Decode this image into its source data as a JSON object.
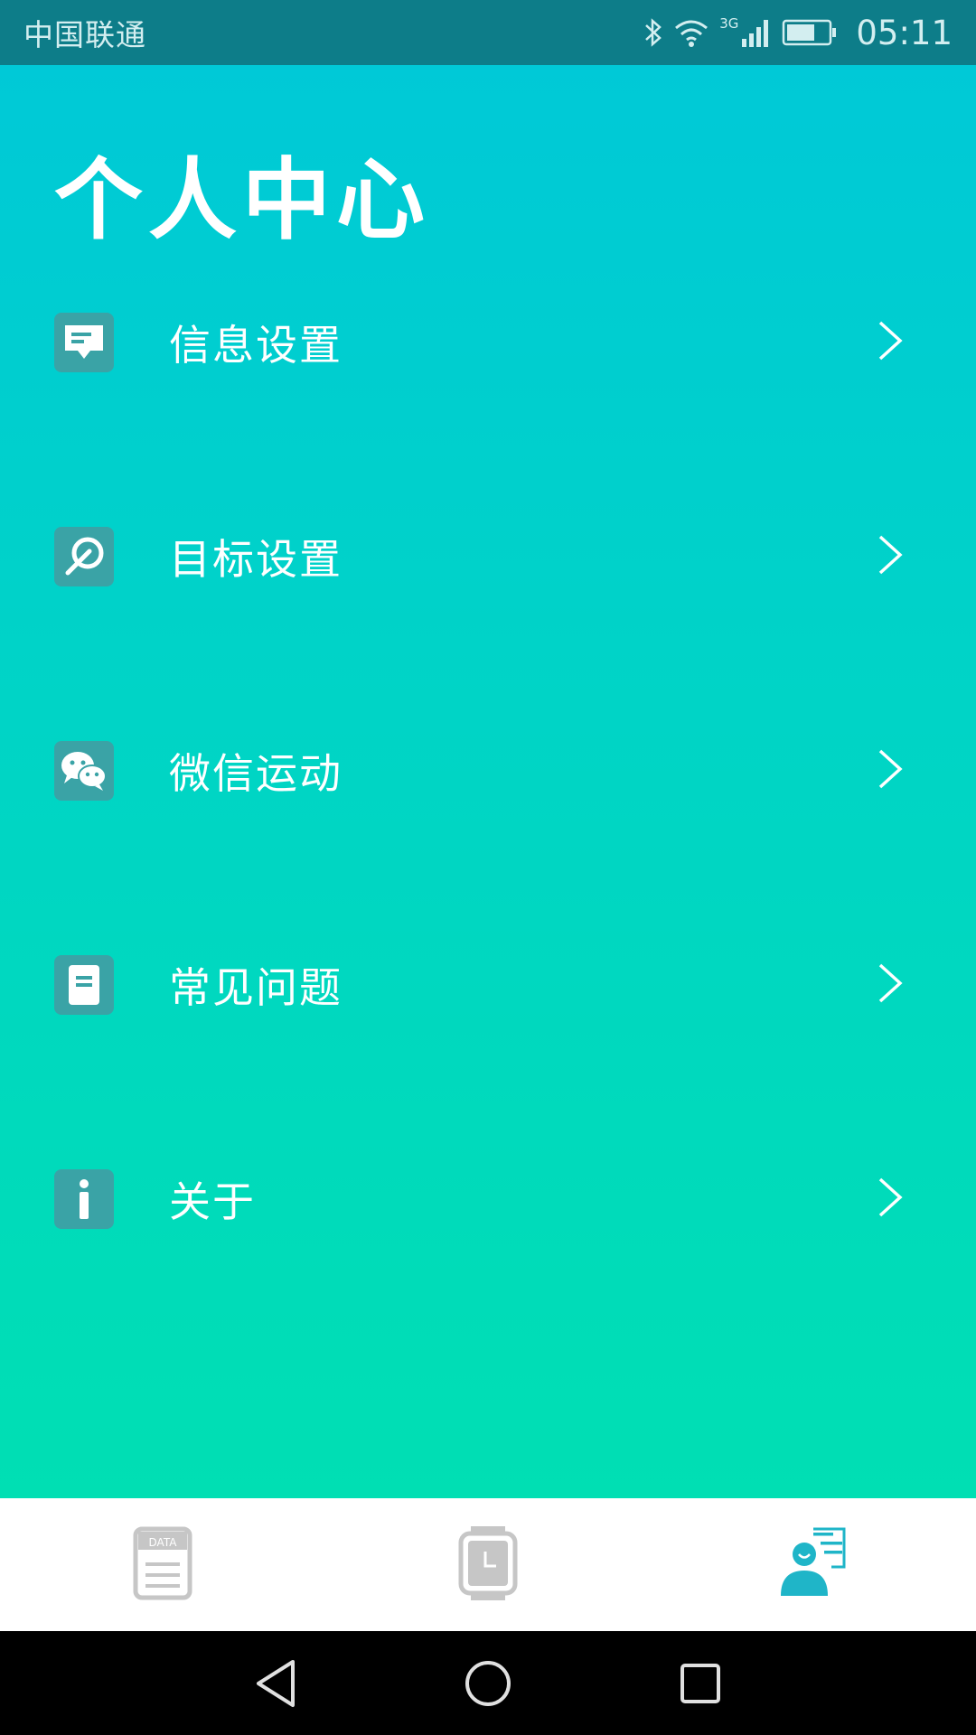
{
  "status_bar": {
    "carrier": "中国联通",
    "network_label": "3G",
    "time": "05:11"
  },
  "page": {
    "title": "个人中心"
  },
  "menu": {
    "items": [
      {
        "label": "信息设置",
        "icon": "message-icon"
      },
      {
        "label": "目标设置",
        "icon": "target-icon"
      },
      {
        "label": "微信运动",
        "icon": "wechat-icon"
      },
      {
        "label": "常见问题",
        "icon": "document-icon"
      },
      {
        "label": "关于",
        "icon": "info-icon"
      }
    ]
  },
  "tab_bar": {
    "tabs": [
      {
        "name": "data",
        "icon_text": "DATA",
        "active": false
      },
      {
        "name": "watch",
        "active": false
      },
      {
        "name": "profile",
        "active": true
      }
    ]
  },
  "colors": {
    "status_bar": "#0d7d89",
    "gradient_top": "#00c9d7",
    "gradient_bottom": "#00dfb3",
    "icon_bg": "#3aa3a6",
    "tab_active": "#1fb5c8",
    "tab_inactive": "#c6c6c6"
  }
}
